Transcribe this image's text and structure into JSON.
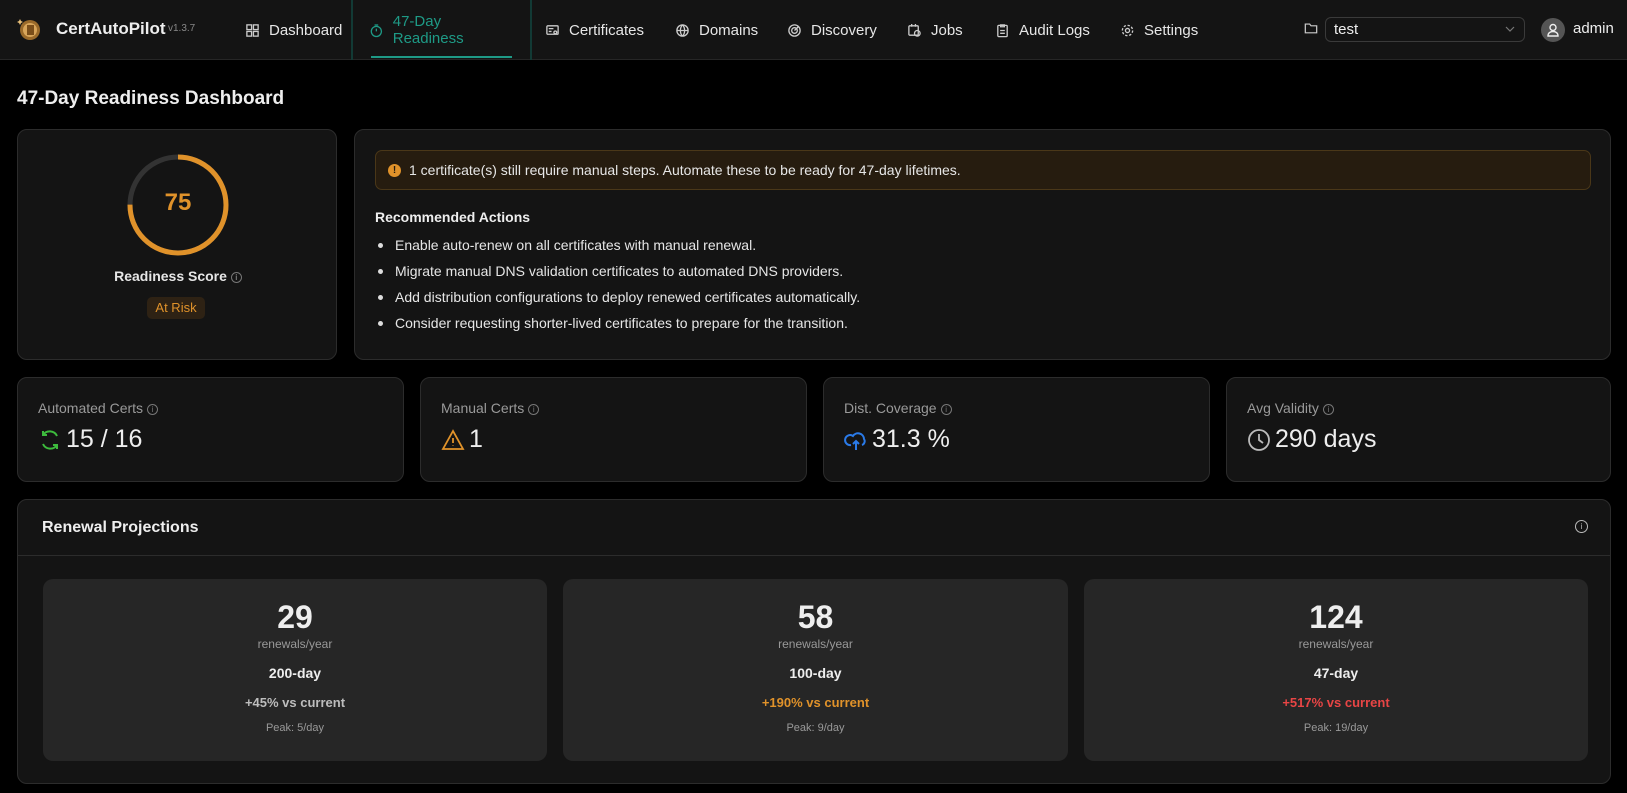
{
  "app": {
    "name": "CertAutoPilot",
    "version": "v1.3.7"
  },
  "nav": [
    {
      "label": "Dashboard",
      "icon": "dashboard-icon"
    },
    {
      "label": "47-Day Readiness",
      "icon": "timer-icon",
      "active": true
    },
    {
      "label": "Certificates",
      "icon": "certificate-icon"
    },
    {
      "label": "Domains",
      "icon": "globe-icon"
    },
    {
      "label": "Discovery",
      "icon": "radar-icon"
    },
    {
      "label": "Jobs",
      "icon": "jobs-icon"
    },
    {
      "label": "Audit Logs",
      "icon": "clipboard-icon"
    },
    {
      "label": "Settings",
      "icon": "gear-icon"
    }
  ],
  "workspace": {
    "selected": "test"
  },
  "user": {
    "name": "admin"
  },
  "page": {
    "title": "47-Day Readiness Dashboard"
  },
  "score": {
    "value": 75,
    "max": 100,
    "label": "Readiness Score",
    "status": "At Risk",
    "color": "#e0922a"
  },
  "alert": {
    "text": "1 certificate(s) still require manual steps. Automate these to be ready for 47-day lifetimes."
  },
  "actions": {
    "title": "Recommended Actions",
    "items": [
      "Enable auto-renew on all certificates with manual renewal.",
      "Migrate manual DNS validation certificates to automated DNS providers.",
      "Add distribution configurations to deploy renewed certificates automatically.",
      "Consider requesting shorter-lived certificates to prepare for the transition."
    ]
  },
  "stats": [
    {
      "label": "Automated Certs",
      "value": "15 / 16",
      "color": "#3dbb3d"
    },
    {
      "label": "Manual Certs",
      "value": "1",
      "color": "#e0922a"
    },
    {
      "label": "Dist. Coverage",
      "value": "31.3 %",
      "color": "#2a7ae8"
    },
    {
      "label": "Avg Validity",
      "value": "290 days",
      "color": "#bbbbbb"
    }
  ],
  "projections": {
    "title": "Renewal Projections",
    "items": [
      {
        "count": "29",
        "unit": "renewals/year",
        "period": "200-day",
        "delta": "+45% vs current",
        "delta_color": "#bdbdbd",
        "peak": "Peak: 5/day"
      },
      {
        "count": "58",
        "unit": "renewals/year",
        "period": "100-day",
        "delta": "+190% vs current",
        "delta_color": "#e0922a",
        "peak": "Peak: 9/day"
      },
      {
        "count": "124",
        "unit": "renewals/year",
        "period": "47-day",
        "delta": "+517% vs current",
        "delta_color": "#e84545",
        "peak": "Peak: 19/day"
      }
    ]
  }
}
